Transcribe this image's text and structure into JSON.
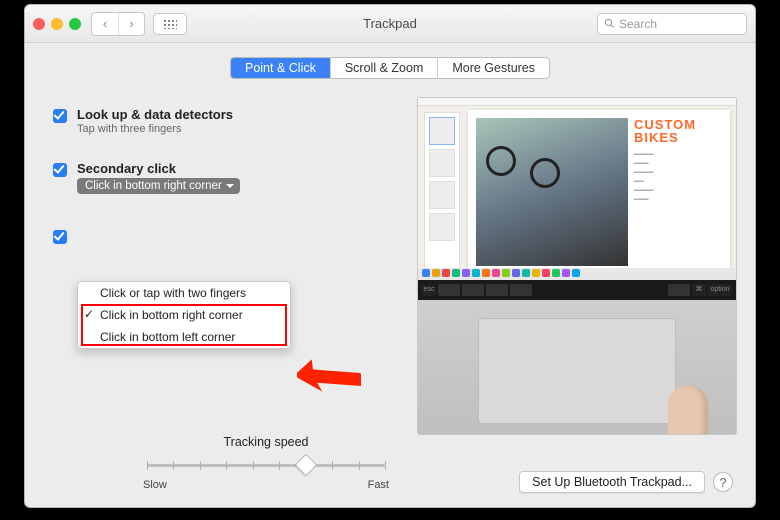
{
  "window": {
    "title": "Trackpad"
  },
  "search": {
    "placeholder": "Search"
  },
  "tabs": [
    {
      "label": "Point & Click",
      "active": true
    },
    {
      "label": "Scroll & Zoom",
      "active": false
    },
    {
      "label": "More Gestures",
      "active": false
    }
  ],
  "options": {
    "lookup": {
      "checked": true,
      "label": "Look up & data detectors",
      "sub": "Tap with three fingers"
    },
    "secondary": {
      "checked": true,
      "label": "Secondary click",
      "selected": "Click in bottom right corner",
      "menu": [
        {
          "label": "Click or tap with two fingers",
          "checked": false
        },
        {
          "label": "Click in bottom right corner",
          "checked": true
        },
        {
          "label": "Click in bottom left corner",
          "checked": false
        }
      ]
    },
    "third": {
      "checked": true
    }
  },
  "slider": {
    "label": "Tracking speed",
    "min_label": "Slow",
    "max_label": "Fast",
    "ticks": 10,
    "value": 6
  },
  "preview": {
    "headline1": "CUSTOM",
    "headline2": "BIKES",
    "touchbar_keys": [
      "esc",
      "",
      "",
      "",
      "",
      "",
      "⌘",
      "option"
    ]
  },
  "footer": {
    "button": "Set Up Bluetooth Trackpad...",
    "help": "?"
  },
  "colors": {
    "accent": "#3b82f6",
    "red": "#ff0000"
  },
  "dock_colors": [
    "#3b82f6",
    "#f59e0b",
    "#ef4444",
    "#10b981",
    "#8b5cf6",
    "#06b6d4",
    "#f97316",
    "#ec4899",
    "#84cc16",
    "#6366f1",
    "#14b8a6",
    "#eab308",
    "#f43f5e",
    "#22c55e",
    "#a855f7",
    "#0ea5e9"
  ]
}
